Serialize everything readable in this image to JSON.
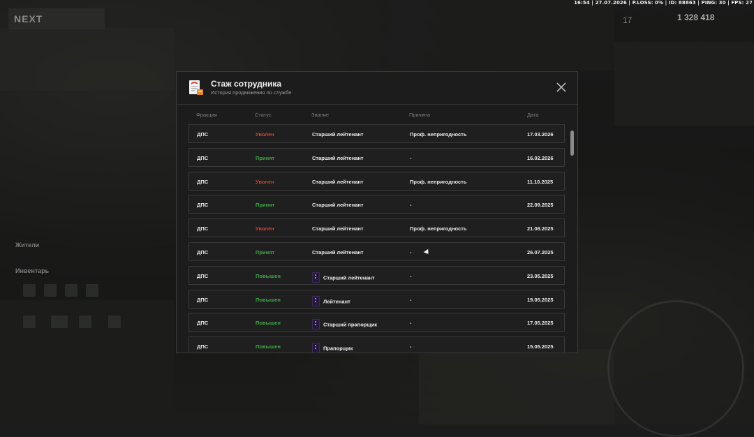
{
  "status_bar": "16:54 | 27.07.2026 | P.LOSS: 0% | ID: 88863 | PING: 30 | FPS: 27",
  "hud": {
    "logo": "NEXT",
    "money": "1 328 418",
    "speed": "17",
    "inventory_label": "Инвентарь",
    "health_label": "Жители"
  },
  "modal": {
    "title": "Стаж сотрудника",
    "subtitle": "История продвижения по службе",
    "columns": {
      "faction": "Фракция",
      "status": "Статус",
      "rank": "Звание",
      "reason": "Причина",
      "date": "Дата"
    },
    "rows": [
      {
        "faction": "ДПС",
        "status": "Уволен",
        "status_color": "red",
        "rank": "Старший лейтенант",
        "rank_icon": false,
        "reason": "Проф. непригодность",
        "date": "17.03.2026"
      },
      {
        "faction": "ДПС",
        "status": "Принят",
        "status_color": "green",
        "rank": "Старший лейтенант",
        "rank_icon": false,
        "reason": "-",
        "date": "16.02.2026"
      },
      {
        "faction": "ДПС",
        "status": "Уволен",
        "status_color": "red",
        "rank": "Старший лейтенант",
        "rank_icon": false,
        "reason": "Проф. непригодность",
        "date": "11.10.2025"
      },
      {
        "faction": "ДПС",
        "status": "Принят",
        "status_color": "green",
        "rank": "Старший лейтенант",
        "rank_icon": false,
        "reason": "-",
        "date": "22.09.2025"
      },
      {
        "faction": "ДПС",
        "status": "Уволен",
        "status_color": "red",
        "rank": "Старший лейтенант",
        "rank_icon": false,
        "reason": "Проф. непригодность",
        "date": "21.08.2025"
      },
      {
        "faction": "ДПС",
        "status": "Принят",
        "status_color": "green",
        "rank": "Старший лейтенант",
        "rank_icon": false,
        "reason": "-",
        "date": "26.07.2025"
      },
      {
        "faction": "ДПС",
        "status": "Повышен",
        "status_color": "green",
        "rank": "Старший лейтенант",
        "rank_icon": true,
        "reason": "-",
        "date": "23.05.2025"
      },
      {
        "faction": "ДПС",
        "status": "Повышен",
        "status_color": "green",
        "rank": "Лейтенант",
        "rank_icon": true,
        "reason": "-",
        "date": "19.05.2025"
      },
      {
        "faction": "ДПС",
        "status": "Повышен",
        "status_color": "green",
        "rank": "Старший прапорщик",
        "rank_icon": true,
        "reason": "-",
        "date": "17.05.2025"
      },
      {
        "faction": "ДПС",
        "status": "Повышен",
        "status_color": "green",
        "rank": "Прапорщик",
        "rank_icon": true,
        "reason": "-",
        "date": "15.05.2025"
      }
    ],
    "icons": {
      "document": "document-icon",
      "close": "close-icon",
      "rank": "rank-insignia-icon"
    }
  }
}
